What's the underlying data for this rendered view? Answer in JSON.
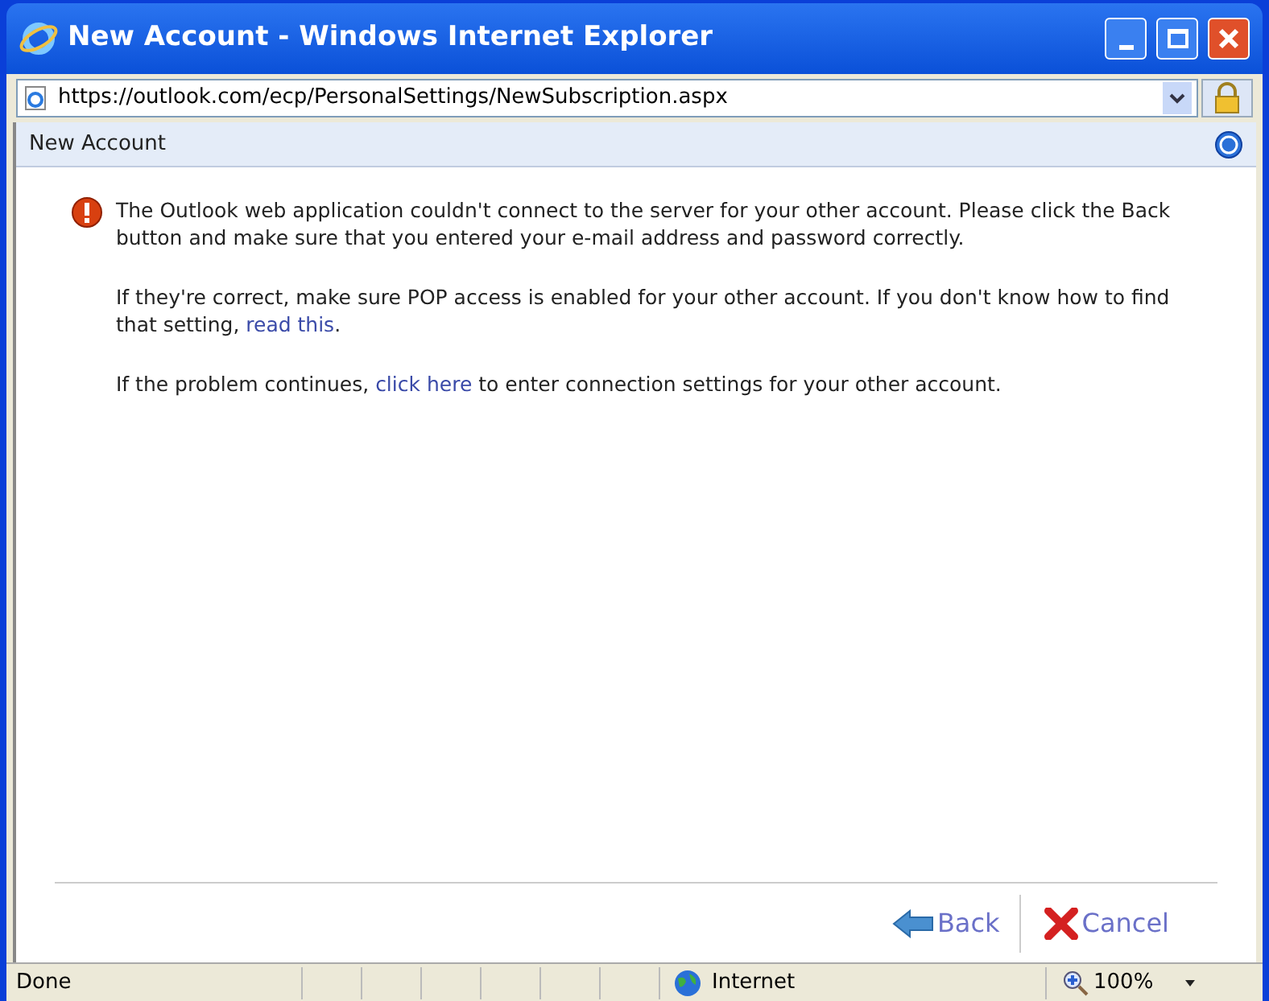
{
  "window": {
    "title": "New Account - Windows Internet Explorer"
  },
  "address_bar": {
    "url": "https://outlook.com/ecp/PersonalSettings/NewSubscription.aspx"
  },
  "page_header": {
    "title": "New Account"
  },
  "message": [
    [
      {
        "kind": "text",
        "text": "The Outlook web application couldn't connect to the server for your other account. Please click the Back button and make sure that you entered your e-mail address and password correctly."
      }
    ],
    [
      {
        "kind": "text",
        "text": "If they're correct, make sure POP access is enabled for your other account. If you don't know how to find that setting, "
      },
      {
        "kind": "link",
        "text": "read this"
      },
      {
        "kind": "text",
        "text": "."
      }
    ],
    [
      {
        "kind": "text",
        "text": "If the problem continues, "
      },
      {
        "kind": "link",
        "text": "click here"
      },
      {
        "kind": "text",
        "text": " to enter connection settings for your other account."
      }
    ]
  ],
  "buttons": [
    {
      "kind": "back",
      "label": "Back"
    },
    {
      "kind": "cancel",
      "label": "Cancel"
    }
  ],
  "status_bar": {
    "status": "Done",
    "zone": "Internet",
    "zoom": "100%"
  }
}
